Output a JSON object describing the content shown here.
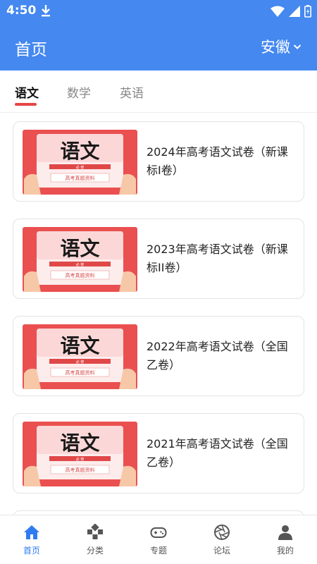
{
  "status_bar": {
    "time": "4:50"
  },
  "app_bar": {
    "title": "首页",
    "region": "安徽"
  },
  "tabs": [
    {
      "label": "语文",
      "active": true
    },
    {
      "label": "数学",
      "active": false
    },
    {
      "label": "英语",
      "active": false
    }
  ],
  "thumbnail": {
    "big_text": "语文",
    "small_label": "必 修",
    "sub_label": "高考真题资料"
  },
  "papers": [
    {
      "title": "2024年高考语文试卷（新课标I卷）"
    },
    {
      "title": "2023年高考语文试卷（新课标II卷）"
    },
    {
      "title": "2022年高考语文试卷（全国乙卷）"
    },
    {
      "title": "2021年高考语文试卷（全国乙卷）"
    }
  ],
  "bottom_nav": [
    {
      "label": "首页",
      "icon": "home-icon",
      "active": true
    },
    {
      "label": "分类",
      "icon": "category-icon",
      "active": false
    },
    {
      "label": "专题",
      "icon": "gamepad-icon",
      "active": false
    },
    {
      "label": "论坛",
      "icon": "aperture-icon",
      "active": false
    },
    {
      "label": "我的",
      "icon": "person-icon",
      "active": false
    }
  ],
  "colors": {
    "primary": "#4488f0",
    "accent_red": "#e54545",
    "nav_active": "#2f7cf0"
  }
}
